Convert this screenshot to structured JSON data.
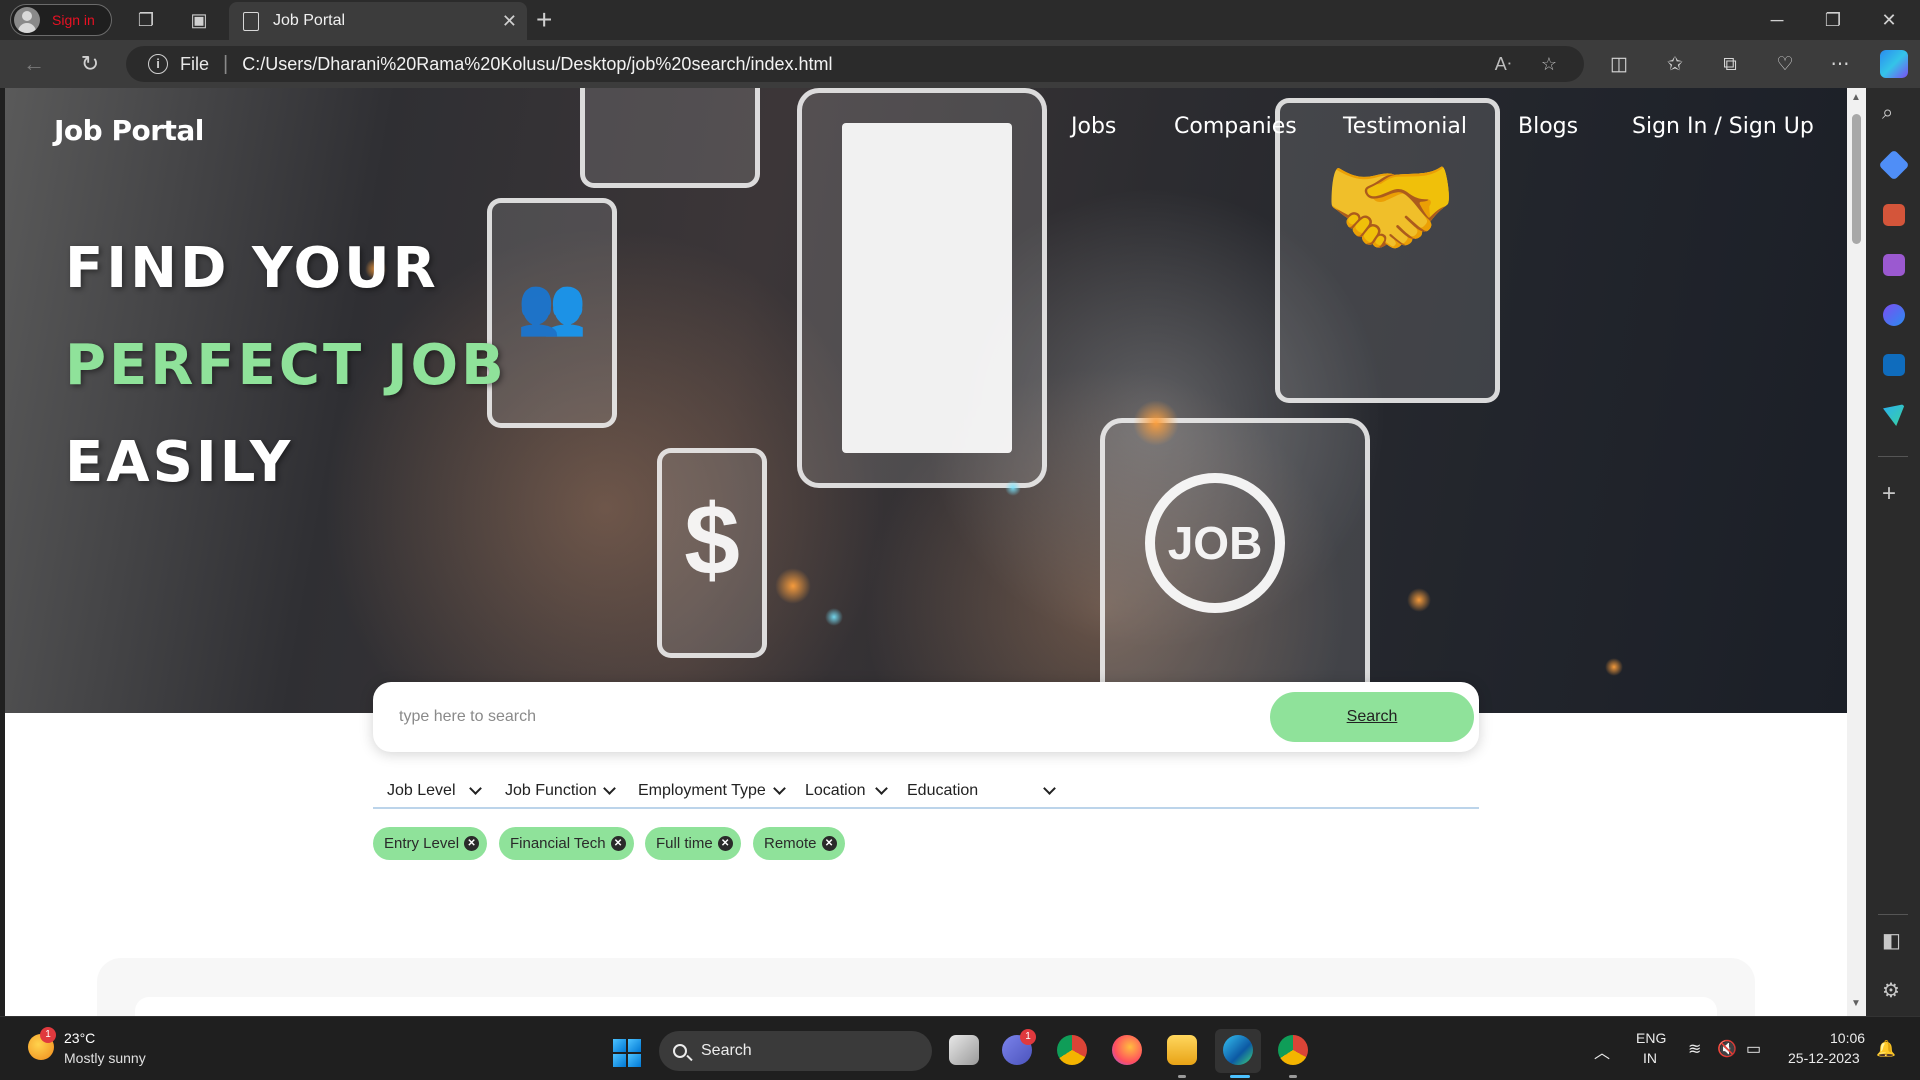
{
  "browser": {
    "profile_label": "Sign in",
    "tab_title": "Job Portal",
    "file_label": "File",
    "url": "C:/Users/Dharani%20Rama%20Kolusu/Desktop/job%20search/index.html"
  },
  "site": {
    "brand": "Job Portal",
    "nav": [
      "Jobs",
      "Companies",
      "Testimonial",
      "Blogs",
      "Sign In / Sign Up"
    ],
    "headline": [
      "FIND YOUR",
      "PERFECT JOB",
      "EASILY"
    ],
    "hero_art": {
      "job_badge": "JOB",
      "dollar": "$"
    },
    "search": {
      "placeholder": "type here to search",
      "button": "Search"
    },
    "filters": [
      "Job Level",
      "Job Function",
      "Employment Type",
      "Location",
      "Education"
    ],
    "chips": [
      "Entry Level",
      "Financial Tech",
      "Full time",
      "Remote"
    ],
    "accent_color": "#8fe29a"
  },
  "taskbar": {
    "weather_badge": "1",
    "temperature": "23°C",
    "weather": "Mostly sunny",
    "search_label": "Search",
    "teams_badge": "1",
    "language_1": "ENG",
    "language_2": "IN",
    "time": "10:06",
    "date": "25-12-2023"
  }
}
